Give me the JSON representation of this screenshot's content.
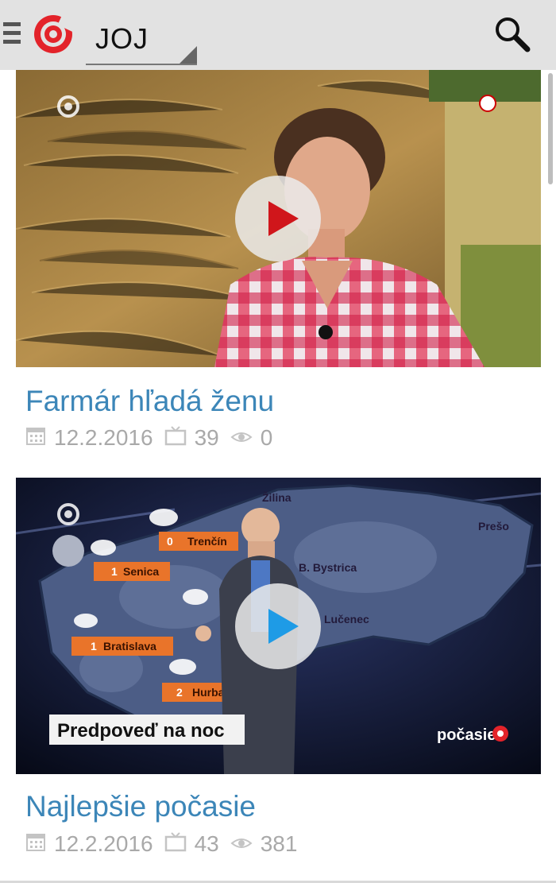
{
  "header": {
    "channel_label": "JOJ",
    "menu_icon": "hamburger-menu-icon",
    "logo_icon": "joj-swirl-logo",
    "search_icon": "search-icon"
  },
  "videos": [
    {
      "title": "Farmár hľadá ženu",
      "date": "12.2.2016",
      "episodes": "39",
      "views": "0",
      "play_color": "#d0161b"
    },
    {
      "title": "Najlepšie počasie",
      "date": "12.2.2016",
      "episodes": "43",
      "views": "381",
      "play_color": "#1e9be6",
      "overlay_caption": "Predpoveď na noc",
      "overlay_brand": "počasie",
      "map_labels": [
        "Žilina",
        "Trenčín",
        "Senica",
        "B. Bystrica",
        "Bratislava",
        "Lučenec",
        "Hurba",
        "Prešo"
      ],
      "map_numbers": [
        "0",
        "1",
        "1",
        "2"
      ]
    }
  ],
  "colors": {
    "title": "#3c86b8",
    "meta": "#a9a9a9",
    "brand_red": "#e3232a"
  }
}
